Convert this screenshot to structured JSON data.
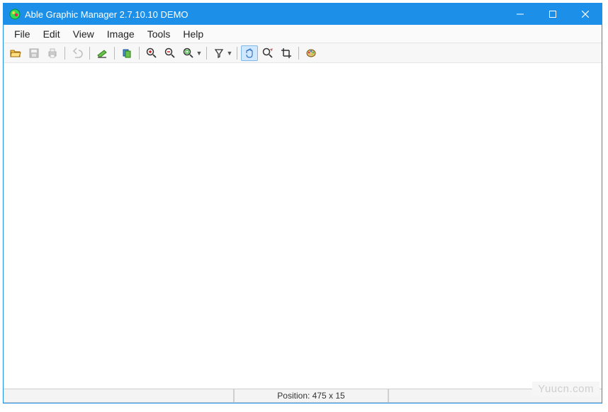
{
  "window": {
    "title": "Able Graphic Manager 2.7.10.10 DEMO"
  },
  "menu": {
    "file": "File",
    "edit": "Edit",
    "view": "View",
    "image": "Image",
    "tools": "Tools",
    "help": "Help"
  },
  "toolbar": {
    "open": "open-icon",
    "save": "save-icon",
    "print": "print-icon",
    "undo": "undo-icon",
    "scanner": "scanner-icon",
    "rotate": "rotate-icon",
    "zoom_in": "zoom-in-icon",
    "zoom_out": "zoom-out-icon",
    "zoom_fit": "zoom-fit-icon",
    "filter": "filter-icon",
    "hand": "hand-icon",
    "zoom_region": "zoom-region-icon",
    "crop": "crop-icon",
    "palette": "palette-icon"
  },
  "status": {
    "position_label": "Position: 475 x 15"
  },
  "watermark": "Yuucn.com"
}
